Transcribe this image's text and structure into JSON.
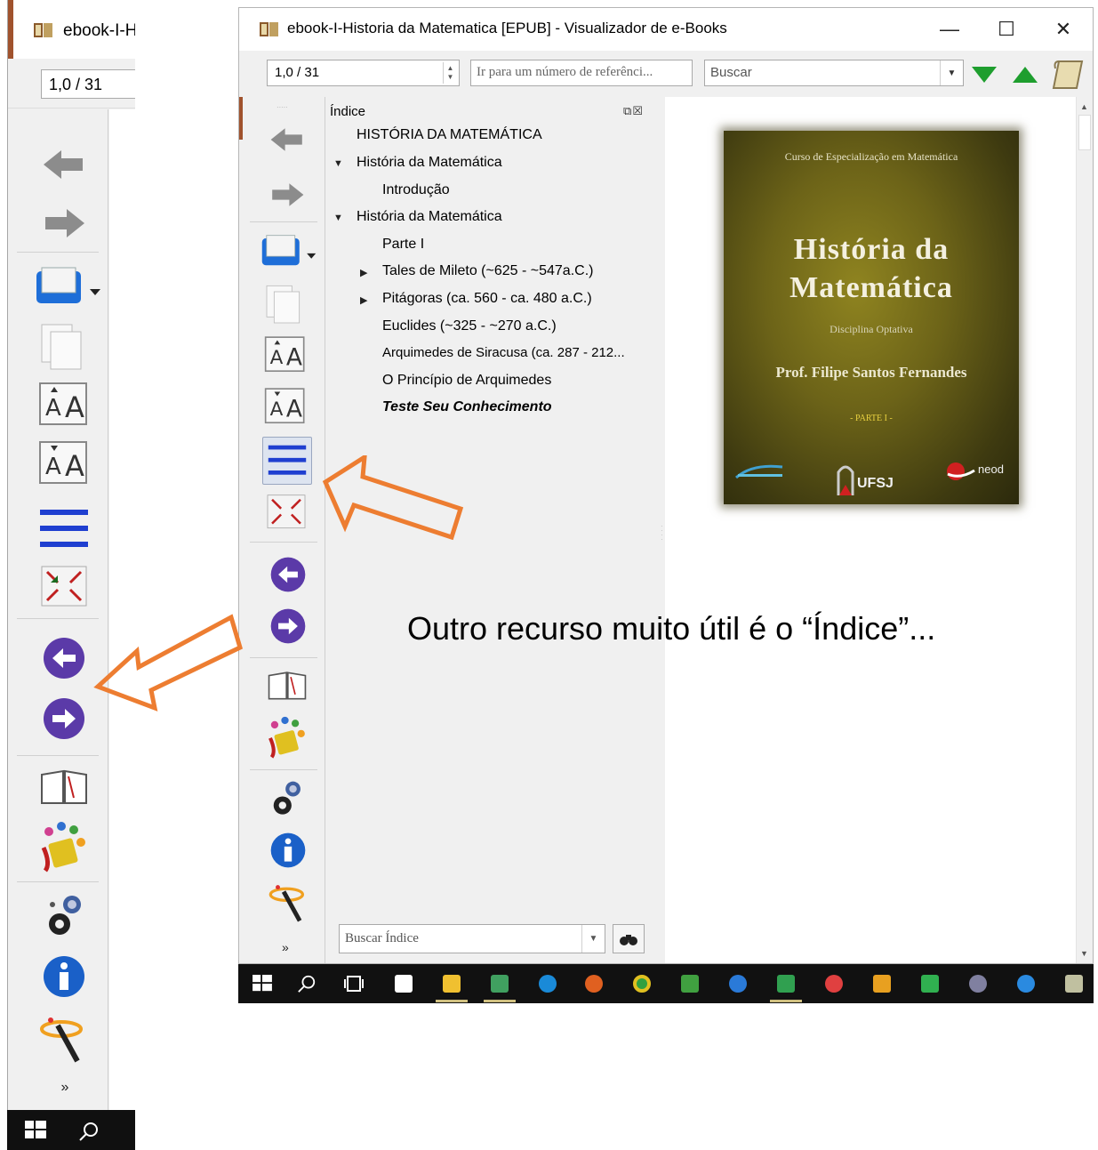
{
  "left_window": {
    "title": "ebook-I-Historia da Matematica [EPUB] - Visualizador de e-Books",
    "page_value": "1,0 / 31"
  },
  "main_window": {
    "title": "ebook-I-Historia da Matematica [EPUB] - Visualizador de e-Books",
    "controls": {
      "minimize": "—",
      "maximize": "☐",
      "close": "✕"
    },
    "toolbar": {
      "page_value": "1,0 / 31",
      "reference_placeholder": "Ir para um número de referênci...",
      "search_placeholder": "Buscar"
    },
    "toc": {
      "title": "Índice",
      "items": [
        {
          "label": "HISTÓRIA DA MATEMÁTICA"
        },
        {
          "label": "História da Matemática"
        },
        {
          "label": "Introdução"
        },
        {
          "label": "História da Matemática"
        },
        {
          "label": "Parte I"
        },
        {
          "label": "Tales de Mileto (~625 - ~547a.C.)"
        },
        {
          "label": "Pitágoras (ca. 560 - ca. 480 a.C.)"
        },
        {
          "label": "Euclides (~325 - ~270 a.C.)"
        },
        {
          "label": "Arquimedes de Siracusa (ca. 287 - 212..."
        },
        {
          "label": "O Princípio de Arquimedes"
        },
        {
          "label": "Teste Seu Conhecimento"
        }
      ],
      "search_placeholder": "Buscar Índice"
    },
    "cover": {
      "course": "Curso de Especialização em Matemática",
      "title_line1": "História da",
      "title_line2": "Matemática",
      "subtitle": "Disciplina Optativa",
      "author": "Prof. Filipe Santos Fernandes",
      "part": "- PARTE I -",
      "logo_ufsj": "UFSJ",
      "logo_neod": "neod"
    }
  },
  "caption": "Outro recurso muito útil é o “Índice”...",
  "colors": {
    "arrow_outline": "#ed7d31",
    "accent_blue": "#1f3fd0",
    "nav_purple": "#5b3aa8",
    "search_green": "#1e9e2e",
    "taskbar": "#111111"
  }
}
